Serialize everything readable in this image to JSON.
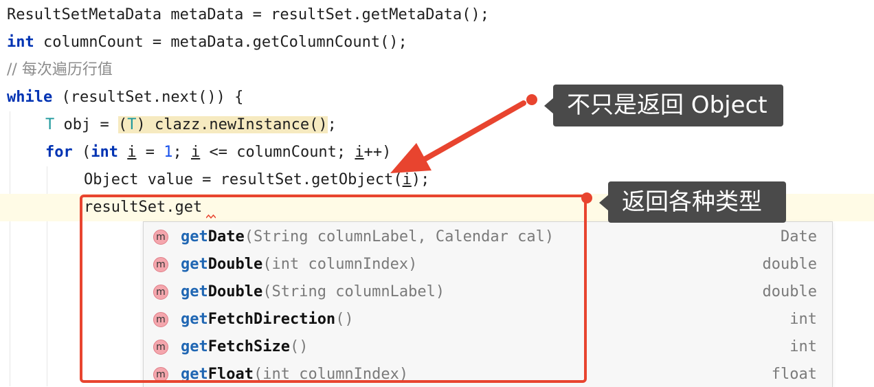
{
  "code": {
    "line1": {
      "a": "ResultSetMetaData metaData = resultSet.getMetaData();"
    },
    "line2": {
      "kw": "int",
      "rest": " columnCount = metaData.getColumnCount();"
    },
    "line3": {
      "comment": "// 每次遍历行值"
    },
    "line4": {
      "kw": "while",
      "rest": " (resultSet.next()) {"
    },
    "line5": {
      "type": "T",
      "mid": " obj = ",
      "cast_open": "(",
      "cast_type": "T",
      "cast_rest": ") clazz.newInstance()",
      "end": ";"
    },
    "line6": {
      "kw": "for",
      "p1": " (",
      "kw2": "int",
      "sp": " ",
      "i1": "i",
      "eq": " = ",
      "num": "1",
      "semi": "; ",
      "i2": "i",
      "cmp": " <= columnCount; ",
      "i3": "i",
      "inc": "++)"
    },
    "line7": {
      "a": "Object value = resultSet.getObject(",
      "i": "i",
      "b": ");"
    },
    "line8": {
      "a": "resultSet.get"
    }
  },
  "completion": {
    "icon_letter": "m",
    "items": [
      {
        "match": "get",
        "rest": "Date",
        "params": "(String columnLabel, Calendar cal)",
        "ret": "Date"
      },
      {
        "match": "get",
        "rest": "Double",
        "params": "(int columnIndex)",
        "ret": "double"
      },
      {
        "match": "get",
        "rest": "Double",
        "params": "(String columnLabel)",
        "ret": "double"
      },
      {
        "match": "get",
        "rest": "FetchDirection",
        "params": "()",
        "ret": "int"
      },
      {
        "match": "get",
        "rest": "FetchSize",
        "params": "()",
        "ret": "int"
      },
      {
        "match": "get",
        "rest": "Float",
        "params": "(int columnIndex)",
        "ret": "float"
      }
    ]
  },
  "annotations": {
    "tip1": "不只是返回 Object",
    "tip2": "返回各种类型",
    "accent_color": "#e8442f",
    "tip_bg_color": "#4a4a4a"
  }
}
